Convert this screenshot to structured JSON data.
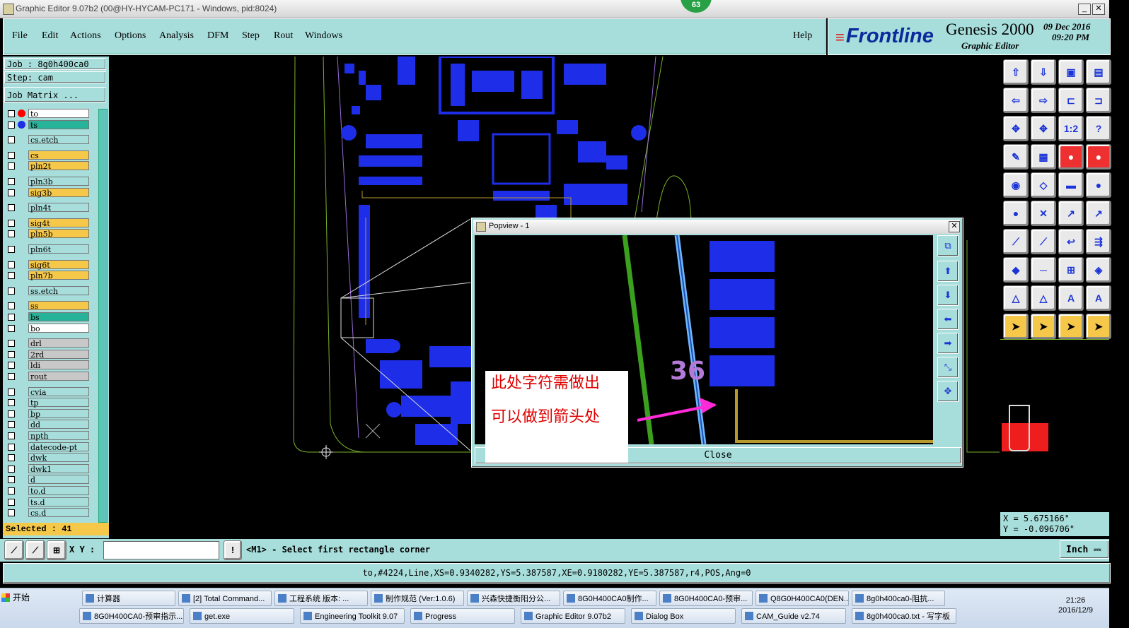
{
  "window": {
    "title": "Graphic Editor 9.07b2 (00@HY-HYCAM-PC171 - Windows, pid:8024)",
    "badge": "63"
  },
  "menu": [
    "File",
    "Edit",
    "Actions",
    "Options",
    "Analysis",
    "DFM",
    "Step",
    "Rout",
    "Windows"
  ],
  "help": "Help",
  "brand": {
    "logo": "Frontline",
    "product": "Genesis 2000",
    "subtitle": "Graphic Editor",
    "date": "09 Dec 2016",
    "time": "09:20 PM"
  },
  "job": {
    "job": "Job : 8g0h400ca0",
    "step": "Step: cam",
    "matrix": "Job Matrix ..."
  },
  "layers": [
    {
      "name": "to",
      "color": "#ffffff",
      "dot": "#ff0000"
    },
    {
      "name": "ts",
      "color": "#27b39a",
      "dot": "#1e2ee8"
    },
    {
      "name": "cs.etch",
      "color": "#a7dedb"
    },
    {
      "name": "cs",
      "color": "#f5c84a"
    },
    {
      "name": "pln2t",
      "color": "#f5c84a"
    },
    {
      "name": "pln3b",
      "color": "#a7dedb"
    },
    {
      "name": "sig3b",
      "color": "#f5c84a"
    },
    {
      "name": "pln4t",
      "color": "#a7dedb"
    },
    {
      "name": "sig4t",
      "color": "#f5c84a"
    },
    {
      "name": "pln5b",
      "color": "#f5c84a"
    },
    {
      "name": "pln6t",
      "color": "#a7dedb"
    },
    {
      "name": "sig6t",
      "color": "#f5c84a"
    },
    {
      "name": "pln7b",
      "color": "#f5c84a"
    },
    {
      "name": "ss.etch",
      "color": "#a7dedb"
    },
    {
      "name": "ss",
      "color": "#f5c84a"
    },
    {
      "name": "bs",
      "color": "#27b39a"
    },
    {
      "name": "bo",
      "color": "#ffffff"
    },
    {
      "name": "drl",
      "color": "#c8c8c8"
    },
    {
      "name": "2rd",
      "color": "#c8c8c8"
    },
    {
      "name": "ldi",
      "color": "#c8c8c8"
    },
    {
      "name": "rout",
      "color": "#c8c8c8"
    },
    {
      "name": "cvia",
      "color": "#a7dedb"
    },
    {
      "name": "tp",
      "color": "#a7dedb"
    },
    {
      "name": "bp",
      "color": "#a7dedb"
    },
    {
      "name": "dd",
      "color": "#a7dedb"
    },
    {
      "name": "npth",
      "color": "#a7dedb"
    },
    {
      "name": "datecode-pt",
      "color": "#a7dedb"
    },
    {
      "name": "dwk",
      "color": "#a7dedb"
    },
    {
      "name": "dwk1",
      "color": "#a7dedb"
    },
    {
      "name": "d",
      "color": "#a7dedb"
    },
    {
      "name": "to.d",
      "color": "#a7dedb"
    },
    {
      "name": "ts.d",
      "color": "#a7dedb"
    },
    {
      "name": "cs.d",
      "color": "#a7dedb"
    }
  ],
  "selected": "Selected : 41",
  "popup": {
    "title": "Popview - 1",
    "label36": "36",
    "close": "Close"
  },
  "note": {
    "line1": "此处字符需做出",
    "line2": "可以做到箭头处"
  },
  "coords": {
    "x": "X =  5.675166\"",
    "y": "Y = -0.096706\""
  },
  "cmd": {
    "xy_label": "X Y :",
    "prompt": "<M1> - Select first rectangle corner",
    "unit": "Inch"
  },
  "status": "to,#4224,Line,XS=0.9340282,YS=5.387587,XE=0.9180282,YE=5.387587,r4,POS,Ang=0",
  "taskbar": {
    "start": "开始",
    "row1": [
      "计算器",
      "[2] Total Command...",
      "工程系统  版本: ...",
      "制作规范 (Ver:1.0.6)",
      "兴森快捷衡阳分公...",
      "8G0H400CA0制作...",
      "8G0H400CA0-预审...",
      "Q8G0H400CA0(DEN...",
      "8g0h400ca0-阻抗..."
    ],
    "row2": [
      "8G0H400CA0-预审指示...",
      "get.exe",
      "Engineering Toolkit 9.07",
      "Progress",
      "Graphic Editor 9.07b2",
      "Dialog Box",
      "CAM_Guide v2.74",
      "8g0h400ca0.txt - 写字板"
    ],
    "clock_time": "21:26",
    "clock_date": "2016/12/9"
  }
}
